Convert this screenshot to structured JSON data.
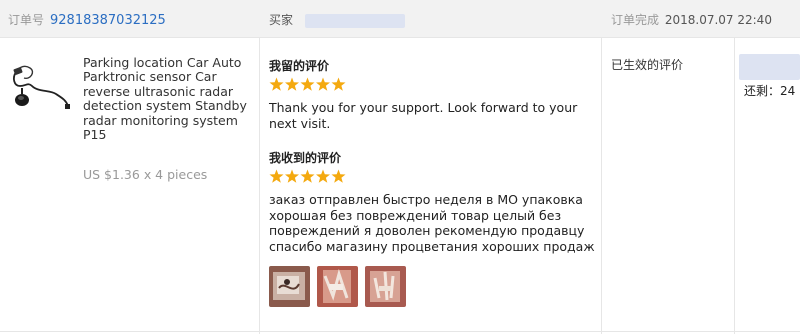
{
  "header": {
    "order_label": "订单号",
    "order_number": "92818387032125",
    "seller_label": "买家",
    "status_label": "订单完成",
    "completed_time": "2018.07.07 22:40"
  },
  "product": {
    "title": "Parking location Car Auto Parktronic sensor Car reverse ultrasonic radar detection system Standby radar monitoring system P15",
    "price": "US $1.36 x 4 pieces"
  },
  "my_review": {
    "title": "我留的评价",
    "stars": 5,
    "text": "Thank you for your support. Look forward to your next visit."
  },
  "received_review": {
    "title": "我收到的评价",
    "stars": 5,
    "text": "заказ отправлен быстро неделя в МО упаковка хорошая без повреждений товар целый без повреждений я доволен рекомендую продавцу спасибо магазину процветания хороших продаж",
    "photo_count": 3
  },
  "status": {
    "label": "已生效的评价"
  },
  "remaining": {
    "label": "还剩：",
    "value": "24"
  },
  "colors": {
    "star": "#f4a90f",
    "link": "#2b6ec2",
    "header_bg": "#f2f2f2"
  }
}
